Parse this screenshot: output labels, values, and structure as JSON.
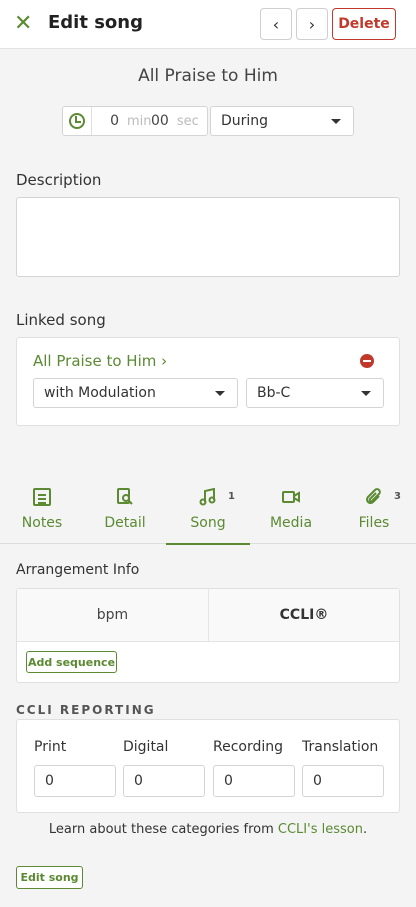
{
  "header": {
    "title": "Edit song",
    "delete_label": "Delete",
    "prev_label": "‹",
    "next_label": "›"
  },
  "song": {
    "title": "All Praise to Him",
    "length_min": "0",
    "min_unit": "min",
    "length_sec": "00",
    "sec_unit": "sec",
    "timing": "During"
  },
  "description": {
    "label": "Description",
    "value": ""
  },
  "linked_song": {
    "label": "Linked song",
    "name": "All Praise to Him",
    "arrangement": "with Modulation",
    "key": "Bb-C"
  },
  "tabs": [
    {
      "label": "Notes",
      "badge": "",
      "icon": "notes-icon",
      "active": false
    },
    {
      "label": "Detail",
      "badge": "",
      "icon": "detail-icon",
      "active": false
    },
    {
      "label": "Song",
      "badge": "1",
      "icon": "music-note-icon",
      "active": true
    },
    {
      "label": "Media",
      "badge": "",
      "icon": "video-icon",
      "active": false
    },
    {
      "label": "Files",
      "badge": "3",
      "icon": "paperclip-icon",
      "active": false
    }
  ],
  "arrangement_info": {
    "label": "Arrangement Info",
    "bpm_label": "bpm",
    "ccli_label": "CCLI®",
    "add_sequence_label": "Add sequence"
  },
  "ccli_reporting": {
    "label": "CCLI REPORTING",
    "columns": [
      {
        "label": "Print",
        "value": "0"
      },
      {
        "label": "Digital",
        "value": "0"
      },
      {
        "label": "Recording",
        "value": "0"
      },
      {
        "label": "Translation",
        "value": "0"
      }
    ],
    "learn_prefix": "Learn about these categories from ",
    "learn_link": "CCLI's lesson",
    "learn_suffix": "."
  },
  "footer": {
    "edit_song_label": "Edit song"
  },
  "colors": {
    "accent": "#5b8a32",
    "danger": "#c0392b"
  }
}
